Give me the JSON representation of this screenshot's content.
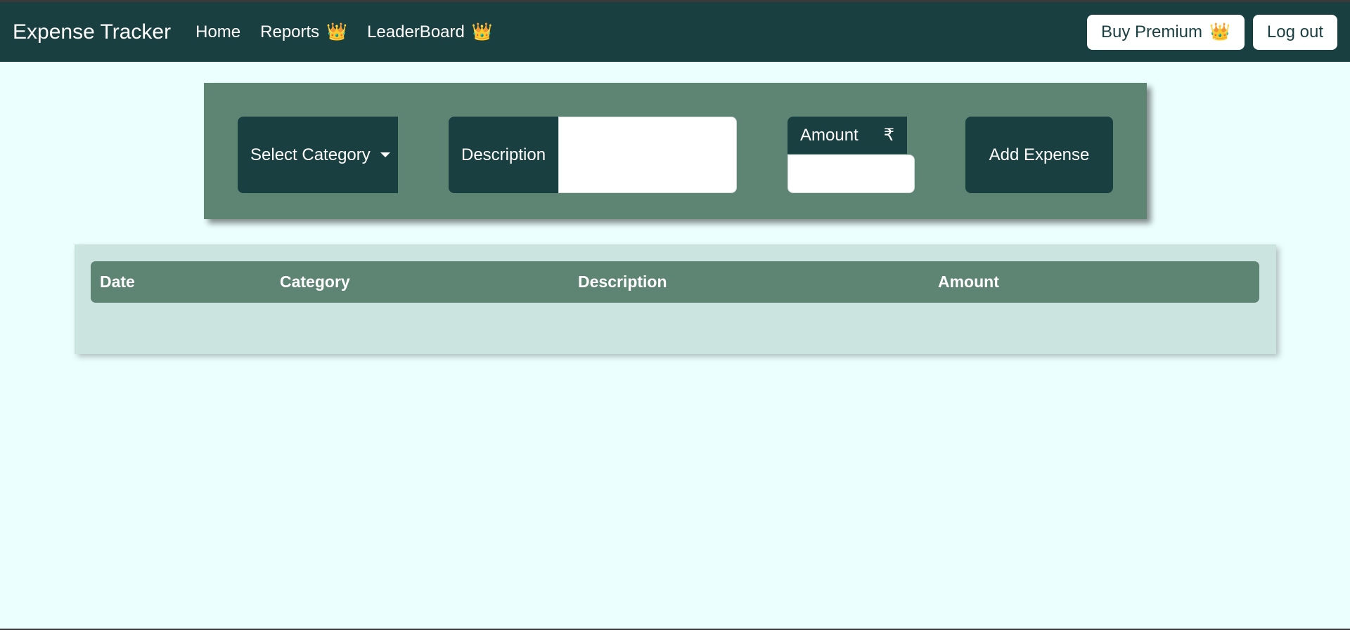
{
  "navbar": {
    "brand": "Expense Tracker",
    "links": [
      {
        "label": "Home"
      },
      {
        "label": "Reports",
        "icon": "crown-icon",
        "icon_glyph": "👑"
      },
      {
        "label": "LeaderBoard",
        "icon": "crown-icon",
        "icon_glyph": "👑"
      }
    ],
    "buy_premium_label": "Buy Premium",
    "buy_premium_icon": "👑",
    "logout_label": "Log out"
  },
  "form": {
    "category_label": "Select Category",
    "description_label": "Description",
    "description_value": "",
    "amount_label": "Amount",
    "currency_symbol": "₹",
    "amount_value": "",
    "add_label": "Add Expense"
  },
  "table": {
    "columns": [
      "Date",
      "Category",
      "Description",
      "Amount"
    ],
    "rows": []
  },
  "colors": {
    "navbar": "#1a3f40",
    "page_bg": "#ecffff",
    "panel": "#5e8474",
    "table_bg": "#cce4df",
    "crown": "#f0a830"
  }
}
